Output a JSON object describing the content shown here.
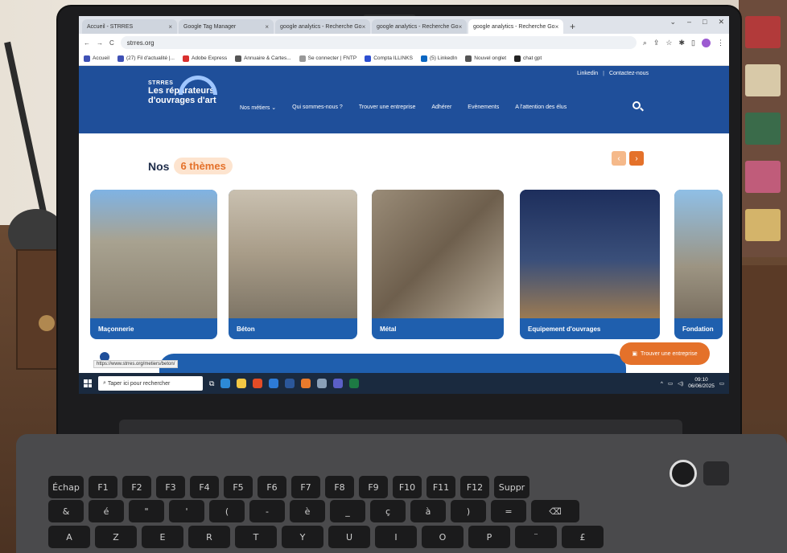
{
  "browser": {
    "tabs": [
      {
        "label": "Accueil - STRRES",
        "active": false
      },
      {
        "label": "Google Tag Manager",
        "active": false
      },
      {
        "label": "google analytics - Recherche Go",
        "active": false
      },
      {
        "label": "google analytics - Recherche Go",
        "active": false
      },
      {
        "label": "google analytics - Recherche Go",
        "active": true
      }
    ],
    "new_tab": "+",
    "url": "strres.org",
    "bookmarks": [
      "Accueil",
      "(27) Fil d'actualité |...",
      "Adobe Express",
      "Annuaire & Cartes...",
      "Se connecter | FNTP",
      "Compta ILLINKS",
      "(5) LinkedIn",
      "Nouvel onglet",
      "chat gpt"
    ]
  },
  "site": {
    "top_links": [
      "Linkedin",
      "Contactez-nous"
    ],
    "logo_small": "STRRES",
    "logo_line1": "Les réparateurs",
    "logo_line2": "d'ouvrages d'art",
    "nav": [
      "Nos métiers",
      "Qui sommes-nous ?",
      "Trouver une entreprise",
      "Adhérer",
      "Evènements",
      "A l'attention des élus"
    ],
    "themes_prefix": "Nos",
    "themes_highlight": "6 thèmes",
    "cards": [
      "Maçonnerie",
      "Béton",
      "Métal",
      "Equipement d'ouvrages",
      "Fondation"
    ],
    "cta": "Trouver une entreprise",
    "status_url": "https://www.strres.org/metiers/beton/"
  },
  "taskbar": {
    "search_placeholder": "Taper ici pour rechercher",
    "time": "09:10",
    "date": "06/06/2025"
  },
  "keyboard": {
    "row1": [
      "Échap",
      "F1",
      "F2",
      "F3",
      "F4",
      "F5",
      "F6",
      "F7",
      "F8",
      "F9",
      "F10",
      "F11",
      "F12",
      "Suppr"
    ],
    "row2": [
      "&",
      "é",
      "\"",
      "'",
      "(",
      "-",
      "è",
      "_",
      "ç",
      "à",
      ")",
      "=",
      "⌫"
    ],
    "row3": [
      "A",
      "Z",
      "E",
      "R",
      "T",
      "Y",
      "U",
      "I",
      "O",
      "P",
      "¨",
      "£"
    ]
  },
  "colors": {
    "brand_blue": "#1f4f9a",
    "accent_orange": "#e4712a"
  }
}
